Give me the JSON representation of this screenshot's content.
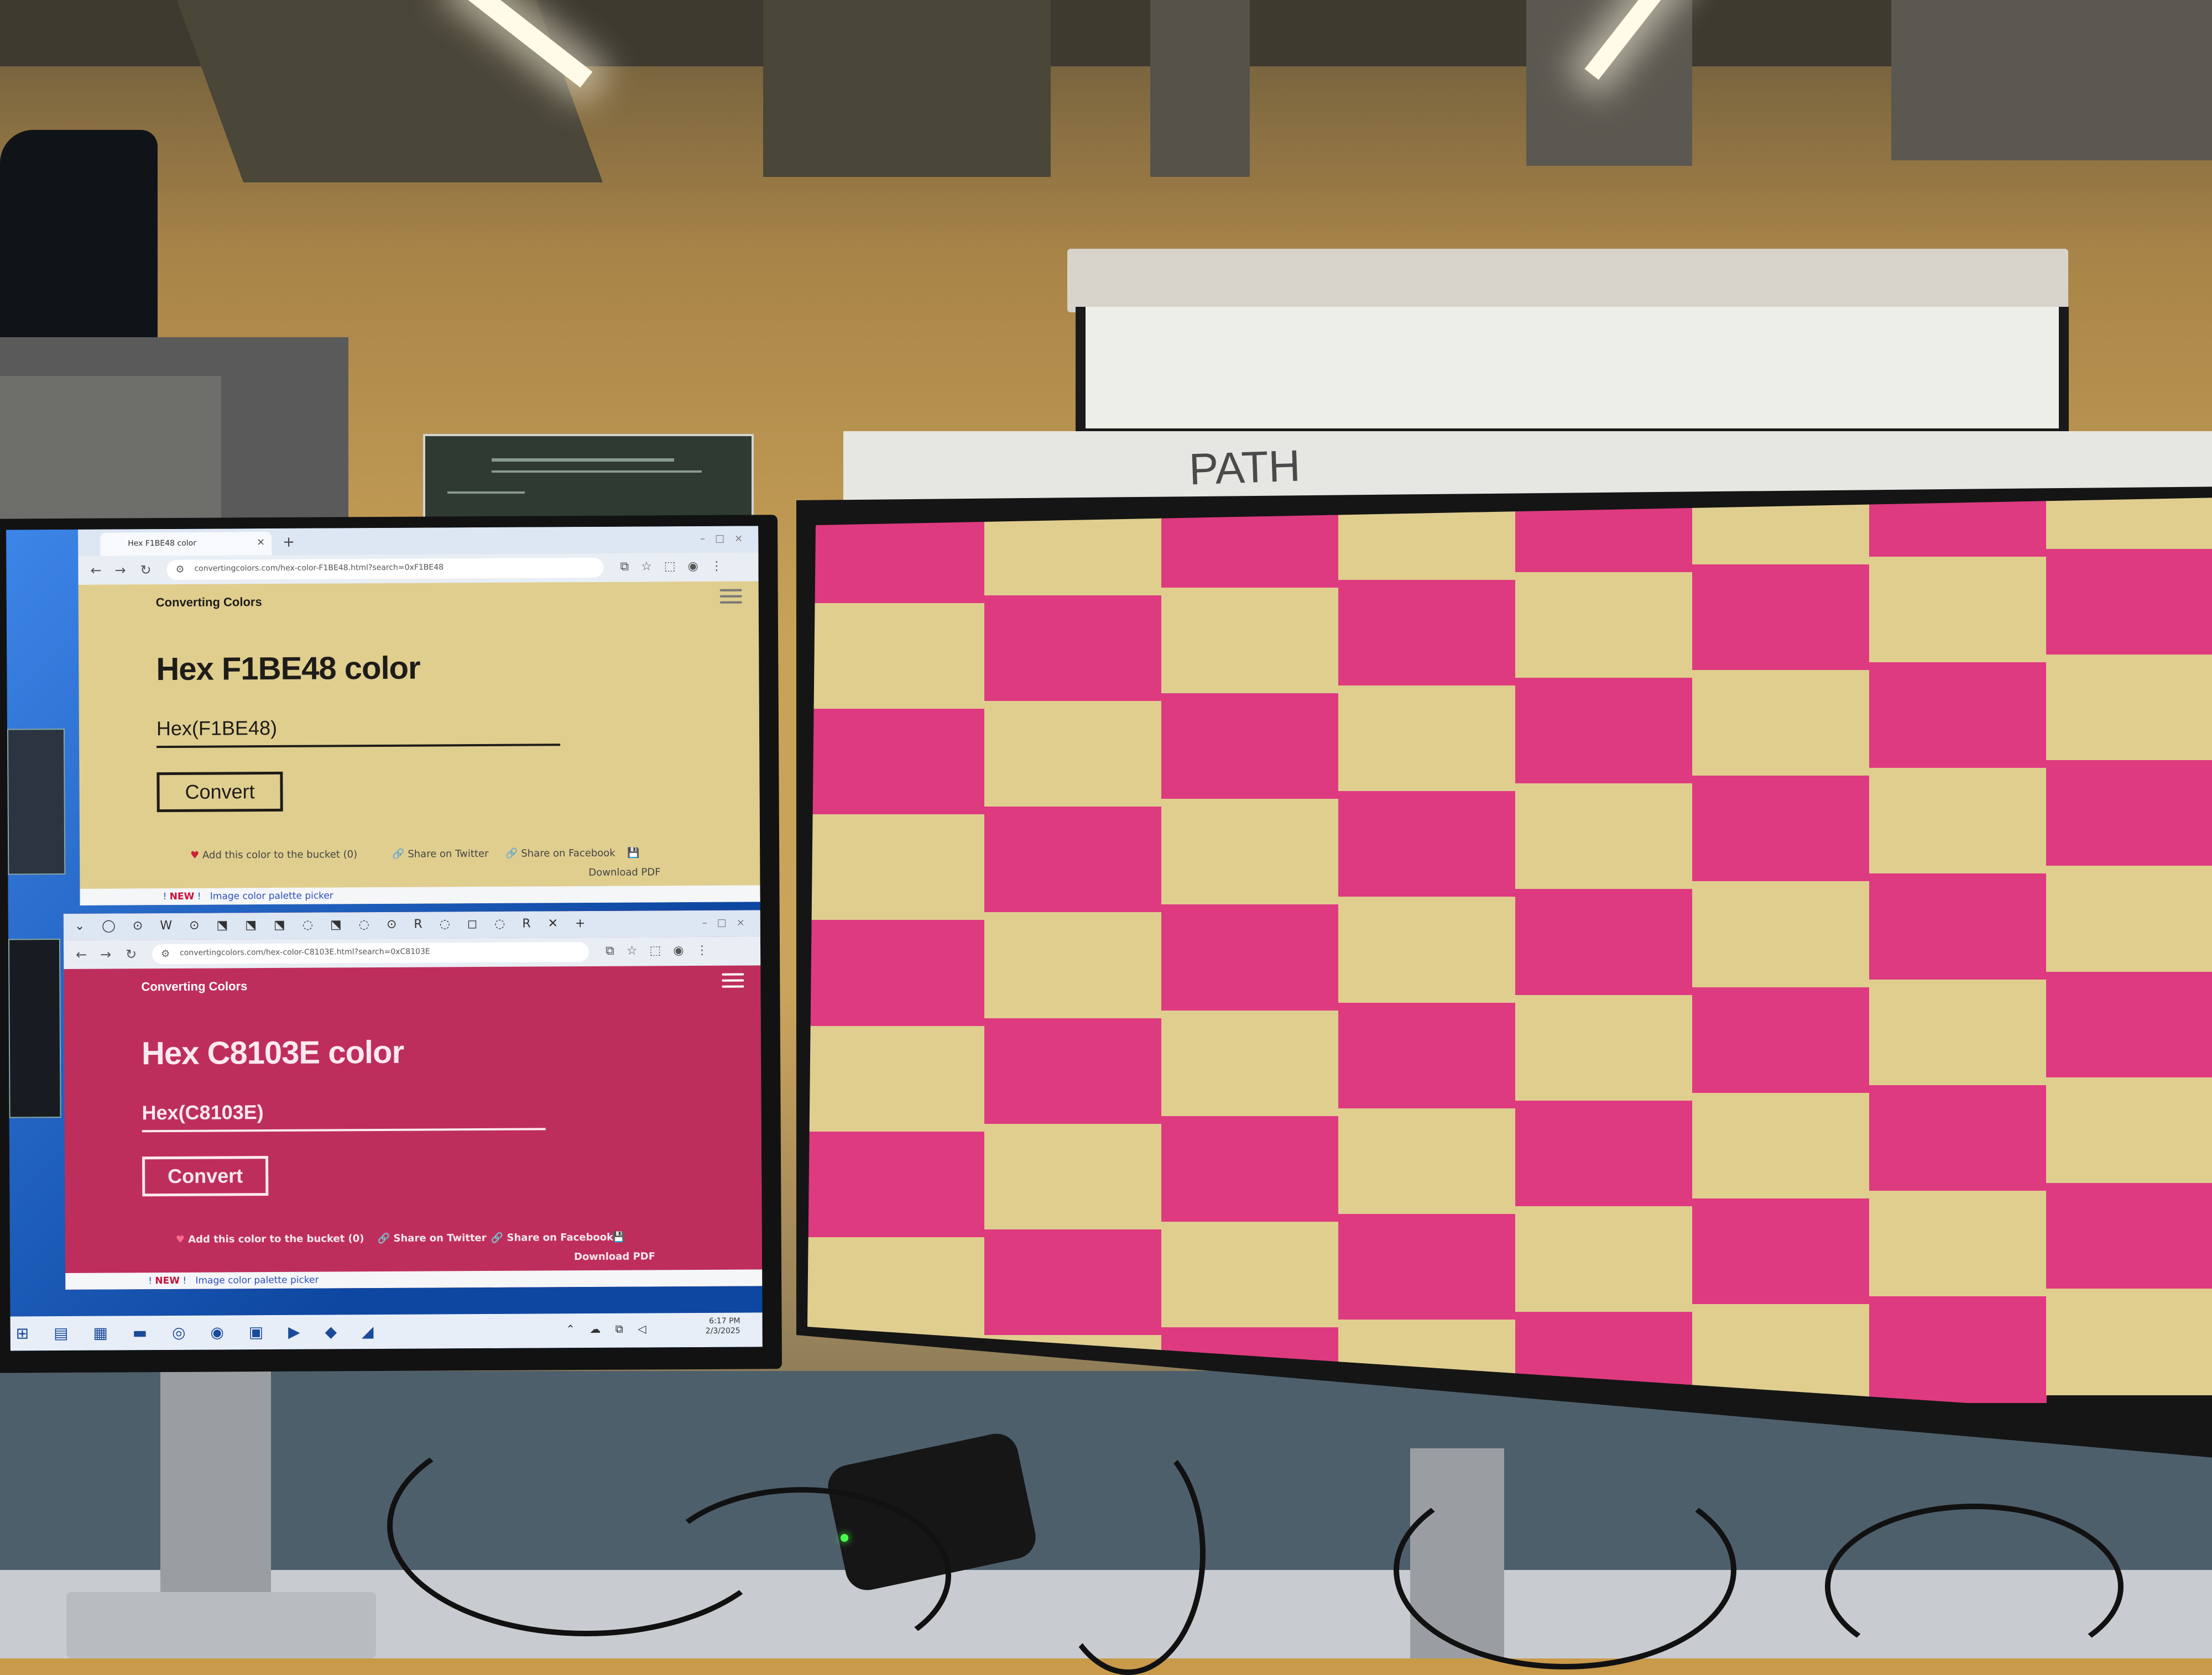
{
  "scene": "photo of two desktop monitors",
  "browser_top": {
    "tab_title": "Hex F1BE48 color",
    "url": "convertingcolors.com/hex-color-F1BE48.html?search=0xF1BE48",
    "site_name": "Converting Colors",
    "heading": "Hex F1BE48 color",
    "input_value": "Hex(F1BE48)",
    "convert_label": "Convert",
    "add_bucket": "Add this color to the bucket (0)",
    "share_twitter": "Share on Twitter",
    "share_facebook": "Share on Facebook",
    "download_pdf": "Download PDF",
    "new_badge": "NEW",
    "new_banner": "Image color palette picker",
    "background_color": "#e0ce8f"
  },
  "browser_bottom": {
    "url": "convertingcolors.com/hex-color-C8103E.html?search=0xC8103E",
    "site_name": "Converting Colors",
    "heading": "Hex C8103E color",
    "input_value": "Hex(C8103E)",
    "convert_label": "Convert",
    "add_bucket": "Add this color to the bucket (0)",
    "share_twitter": "Share on Twitter",
    "share_facebook": "Share on Facebook",
    "download_pdf": "Download PDF",
    "new_badge": "NEW",
    "new_banner": "Image color palette picker",
    "background_color": "#be2e5c"
  },
  "taskbar": {
    "time": "6:17 PM",
    "date": "2/3/2025"
  },
  "right_monitor": {
    "pattern": "checkerboard",
    "colors": [
      "#de3a80",
      "#e0ce8f"
    ]
  },
  "whiteboard_text": "PATH"
}
